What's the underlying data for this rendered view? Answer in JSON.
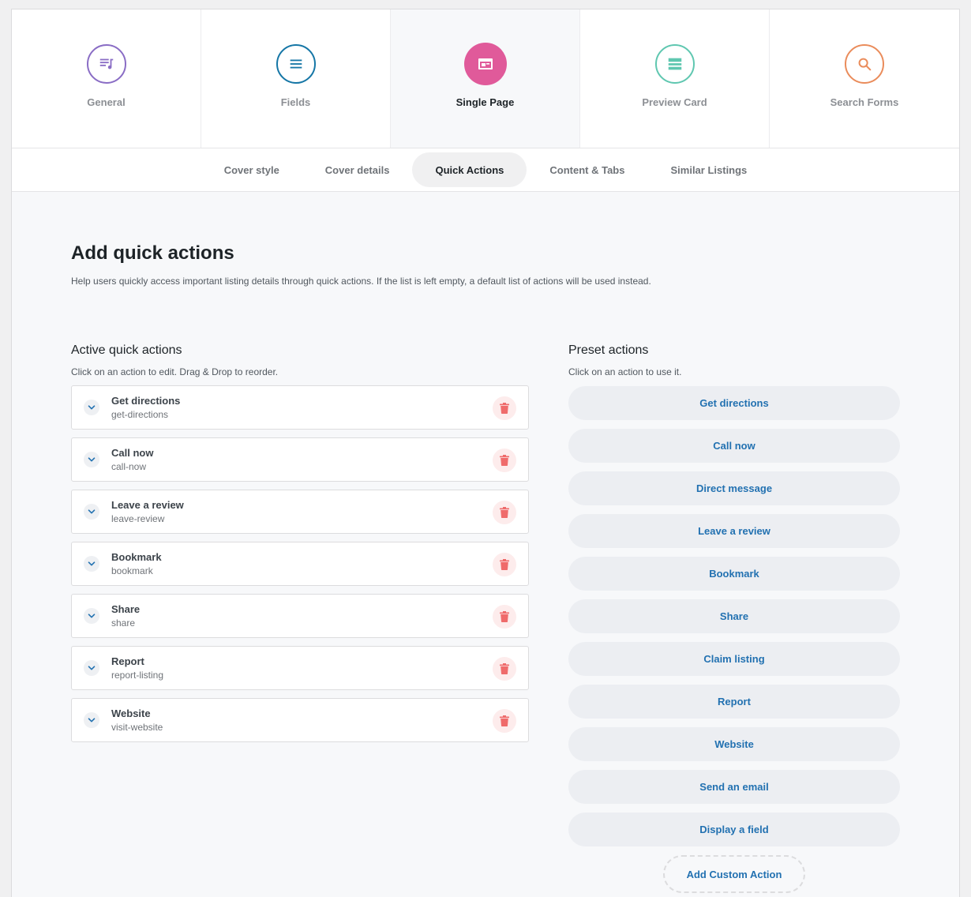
{
  "colors": {
    "general": "#8a6dc5",
    "fields": "#1576a6",
    "single_page": "#e05a9a",
    "preview_card": "#5fc7b0",
    "search_forms": "#ea8c5b",
    "link": "#2271b1",
    "trash": "#ef6b6b"
  },
  "tabs": [
    {
      "label": "General",
      "icon": "music-list-icon"
    },
    {
      "label": "Fields",
      "icon": "hamburger-list-icon"
    },
    {
      "label": "Single Page",
      "icon": "browser-window-icon"
    },
    {
      "label": "Preview Card",
      "icon": "card-layout-icon"
    },
    {
      "label": "Search Forms",
      "icon": "search-icon"
    }
  ],
  "subtabs": [
    "Cover style",
    "Cover details",
    "Quick Actions",
    "Content & Tabs",
    "Similar Listings"
  ],
  "page": {
    "title": "Add quick actions",
    "description": "Help users quickly access important listing details through quick actions. If the list is left empty, a default list of actions will be used instead."
  },
  "active": {
    "title": "Active quick actions",
    "subtitle": "Click on an action to edit. Drag & Drop to reorder.",
    "items": [
      {
        "label": "Get directions",
        "slug": "get-directions"
      },
      {
        "label": "Call now",
        "slug": "call-now"
      },
      {
        "label": "Leave a review",
        "slug": "leave-review"
      },
      {
        "label": "Bookmark",
        "slug": "bookmark"
      },
      {
        "label": "Share",
        "slug": "share"
      },
      {
        "label": "Report",
        "slug": "report-listing"
      },
      {
        "label": "Website",
        "slug": "visit-website"
      }
    ]
  },
  "preset": {
    "title": "Preset actions",
    "subtitle": "Click on an action to use it.",
    "items": [
      "Get directions",
      "Call now",
      "Direct message",
      "Leave a review",
      "Bookmark",
      "Share",
      "Claim listing",
      "Report",
      "Website",
      "Send an email",
      "Display a field"
    ],
    "custom_label": "Add Custom Action"
  }
}
